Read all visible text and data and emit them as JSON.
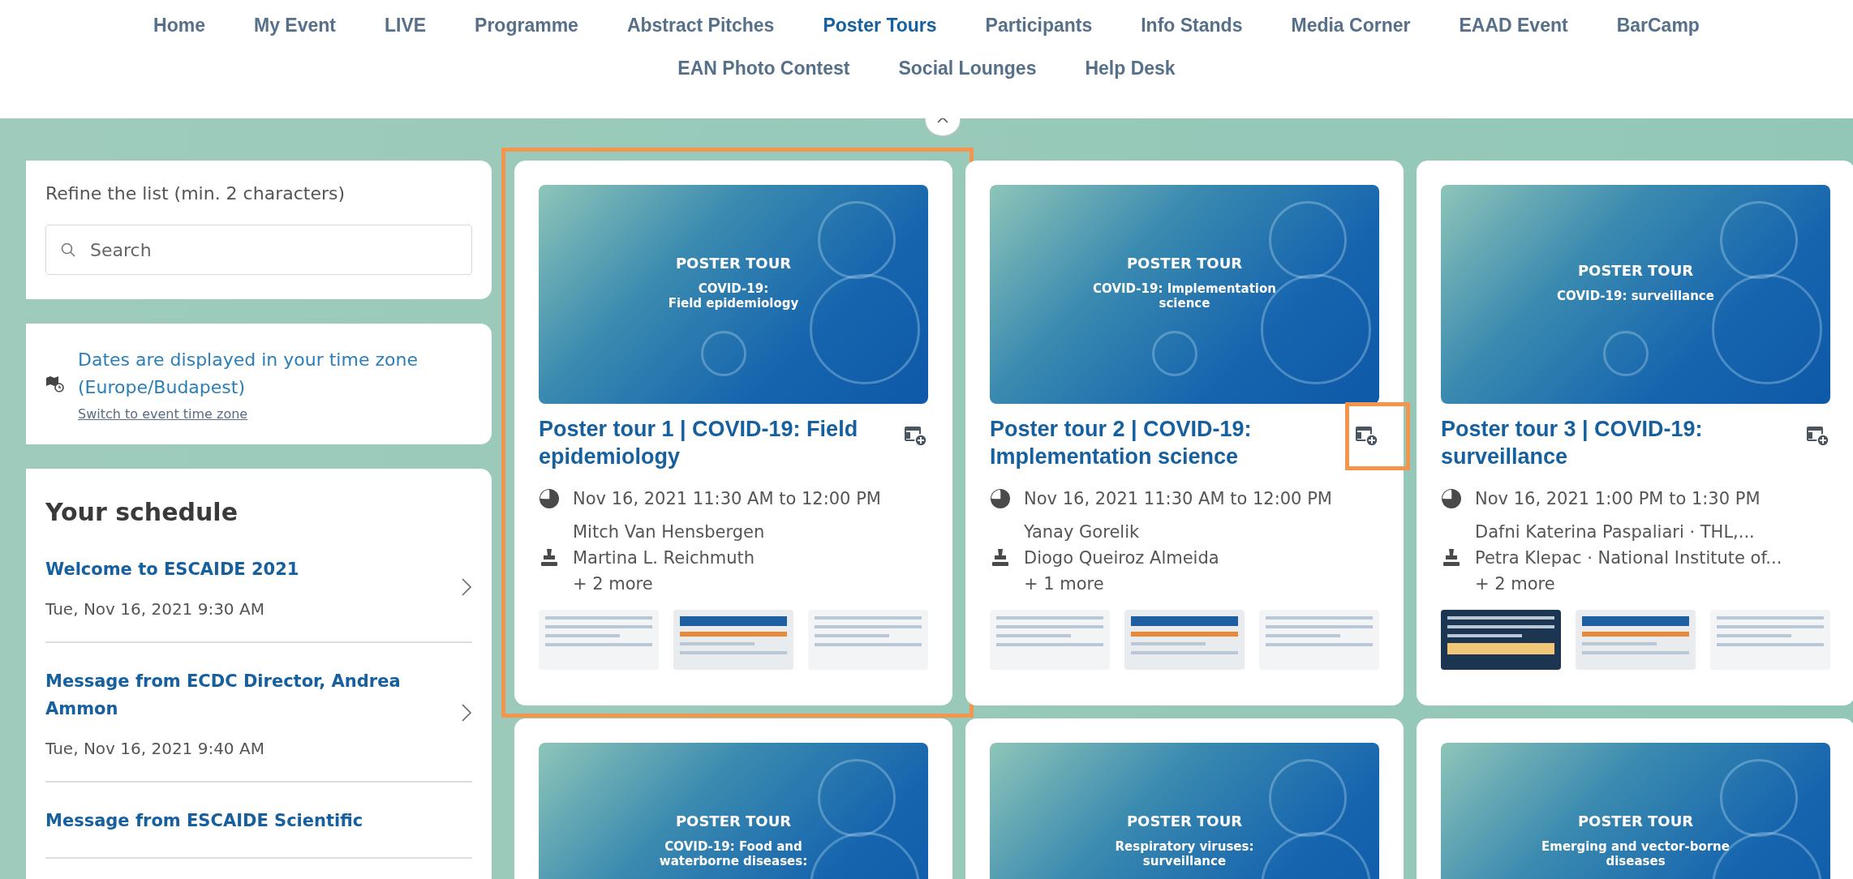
{
  "nav": {
    "items": [
      {
        "label": "Home",
        "selected": false
      },
      {
        "label": "My Event",
        "selected": false
      },
      {
        "label": "LIVE",
        "selected": false
      },
      {
        "label": "Programme",
        "selected": false
      },
      {
        "label": "Abstract Pitches",
        "selected": false
      },
      {
        "label": "Poster Tours",
        "selected": true
      },
      {
        "label": "Participants",
        "selected": false
      },
      {
        "label": "Info Stands",
        "selected": false
      },
      {
        "label": "Media Corner",
        "selected": false
      },
      {
        "label": "EAAD Event",
        "selected": false
      },
      {
        "label": "BarCamp",
        "selected": false
      },
      {
        "label": "EAN Photo Contest",
        "selected": false
      },
      {
        "label": "Social Lounges",
        "selected": false
      },
      {
        "label": "Help Desk",
        "selected": false
      }
    ]
  },
  "sidebar": {
    "refine_label": "Refine the list (min. 2 characters)",
    "search": {
      "placeholder": "Search"
    },
    "timezone": {
      "text": "Dates are displayed in your time zone (Europe/Budapest)",
      "link": "Switch to event time zone"
    },
    "schedule": {
      "title": "Your schedule",
      "items": [
        {
          "title": "Welcome to ESCAIDE 2021",
          "date": "Tue, Nov 16, 2021 9:30 AM"
        },
        {
          "title": "Message from ECDC Director, Andrea Ammon",
          "date": "Tue, Nov 16, 2021 9:40 AM"
        },
        {
          "title": "Message from ESCAIDE Scientific"
        }
      ]
    }
  },
  "tours": [
    {
      "banner_title": "POSTER TOUR",
      "banner_subtitle": "COVID-19:\nField epidemiology",
      "title": "Poster tour 1 | COVID-19: Field epidemiology",
      "time": "Nov 16, 2021 11:30 AM to 12:00 PM",
      "people": [
        "Mitch Van Hensbergen",
        "Martina L. Reichmuth"
      ],
      "more": "+ 2 more",
      "highlighted": true,
      "add_highlighted": false
    },
    {
      "banner_title": "POSTER TOUR",
      "banner_subtitle": "COVID-19: Implementation\nscience",
      "title": "Poster tour 2 | COVID-19: Implementation science",
      "time": "Nov 16, 2021 11:30 AM to 12:00 PM",
      "people": [
        "Yanay Gorelik",
        "Diogo Queiroz Almeida"
      ],
      "more": "+ 1 more",
      "highlighted": false,
      "add_highlighted": true
    },
    {
      "banner_title": "POSTER TOUR",
      "banner_subtitle": "COVID-19: surveillance",
      "title": "Poster tour 3 | COVID-19: surveillance",
      "time": "Nov 16, 2021 1:00 PM to 1:30 PM",
      "people": [
        "Dafni Katerina Paspaliari · THL,...",
        "Petra Klepac · National Institute of..."
      ],
      "more": "+ 2 more",
      "highlighted": false,
      "add_highlighted": false
    },
    {
      "banner_title": "POSTER TOUR",
      "banner_subtitle": "COVID-19: Food and\nwaterborne diseases:",
      "highlighted": false,
      "add_highlighted": false
    },
    {
      "banner_title": "POSTER TOUR",
      "banner_subtitle": "Respiratory viruses:\nsurveillance",
      "highlighted": false,
      "add_highlighted": false
    },
    {
      "banner_title": "POSTER TOUR",
      "banner_subtitle": "Emerging and vector-borne\ndiseases",
      "highlighted": false,
      "add_highlighted": false
    }
  ]
}
